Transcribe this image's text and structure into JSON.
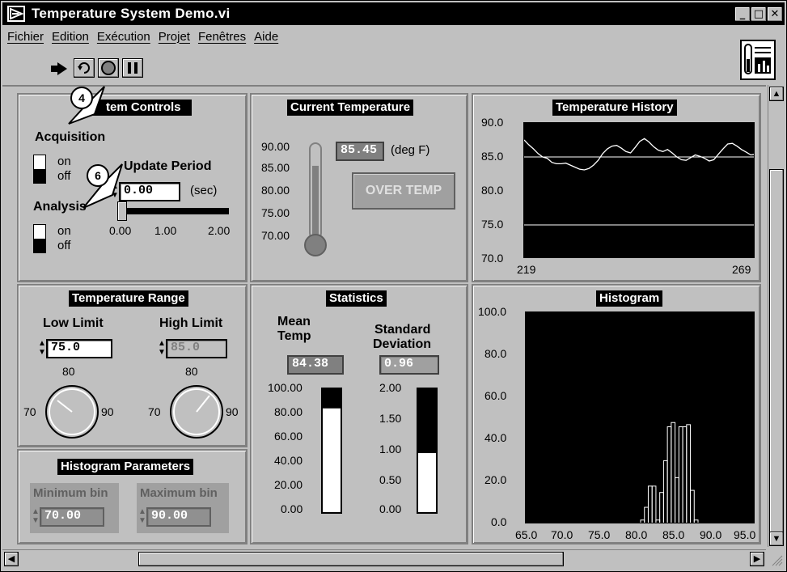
{
  "window": {
    "title": "Temperature System Demo.vi"
  },
  "menu": [
    "Fichier",
    "Edition",
    "Exécution",
    "Projet",
    "Fenêtres",
    "Aide"
  ],
  "callouts": [
    "4",
    "6"
  ],
  "system_controls": {
    "title": "System Controls",
    "visible_title": "tem Controls",
    "acquisition_label": "Acquisition",
    "analysis_label": "Analysis",
    "on": "on",
    "off": "off",
    "update_period_label": "Update Period",
    "update_period_value": "0.00",
    "update_period_unit": "(sec)",
    "slider_ticks": [
      "0.00",
      "1.00",
      "2.00"
    ]
  },
  "current_temp": {
    "title": "Current Temperature",
    "value": "85.45",
    "unit": "(deg F)",
    "over_temp_label": "OVER TEMP",
    "scale": [
      "90.00",
      "85.00",
      "80.00",
      "75.00",
      "70.00"
    ]
  },
  "temp_history": {
    "title": "Temperature History",
    "y_ticks": [
      "90.0",
      "85.0",
      "80.0",
      "75.0",
      "70.0"
    ],
    "x_ticks": [
      "219",
      "269"
    ]
  },
  "temp_range": {
    "title": "Temperature Range",
    "low_label": "Low Limit",
    "high_label": "High Limit",
    "low_value": "75.0",
    "high_value": "85.0",
    "knob_top": "80",
    "knob_min": "70",
    "knob_max": "90"
  },
  "statistics": {
    "title": "Statistics",
    "mean_label_1": "Mean",
    "mean_label_2": "Temp",
    "std_label_1": "Standard",
    "std_label_2": "Deviation",
    "mean_value": "84.38",
    "std_value": "0.96",
    "mean_scale": [
      "100.00",
      "80.00",
      "60.00",
      "40.00",
      "20.00",
      "0.00"
    ],
    "std_scale": [
      "2.00",
      "1.50",
      "1.00",
      "0.50",
      "0.00"
    ]
  },
  "histogram": {
    "title": "Histogram",
    "y_ticks": [
      "100.0",
      "80.0",
      "60.0",
      "40.0",
      "20.0",
      "0.0"
    ],
    "x_ticks": [
      "65.0",
      "70.0",
      "75.0",
      "80.0",
      "85.0",
      "90.0",
      "95.0"
    ]
  },
  "histogram_params": {
    "title": "Histogram Parameters",
    "min_label": "Minimum bin",
    "max_label": "Maximum bin",
    "min_value": "70.00",
    "max_value": "90.00"
  },
  "chart_data": [
    {
      "type": "line",
      "title": "Temperature History",
      "xlim": [
        219,
        269
      ],
      "ylim": [
        70,
        90
      ],
      "series": [
        {
          "values": [
            87.5,
            86.8,
            86.2,
            85.5,
            85.0,
            84.8,
            84.2,
            84.0,
            84.0,
            84.1,
            83.8,
            83.5,
            83.2,
            83.1,
            83.3,
            83.8,
            84.5,
            85.5,
            86.2,
            86.6,
            86.7,
            86.3,
            85.8,
            85.6,
            86.4,
            87.3,
            87.7,
            87.2,
            86.5,
            86.0,
            85.8,
            86.1,
            85.6,
            85.0,
            84.6,
            84.5,
            84.9,
            85.3,
            85.1,
            84.8,
            84.4,
            84.6,
            85.4,
            86.2,
            86.9,
            87.0,
            86.6,
            86.1,
            85.7,
            85.3,
            85.4
          ]
        }
      ],
      "reference_lines": [
        85.0,
        75.0
      ]
    },
    {
      "type": "bar",
      "title": "Histogram",
      "xlim": [
        65,
        95
      ],
      "ylim": [
        0,
        100
      ],
      "bins_x": [
        80.0,
        80.5,
        81.0,
        81.5,
        82.0,
        82.5,
        83.0,
        83.5,
        84.0,
        84.5,
        85.0,
        85.5,
        86.0,
        86.5,
        87.0
      ],
      "values": [
        2,
        8,
        18,
        18,
        2,
        15,
        30,
        46,
        48,
        22,
        46,
        46,
        47,
        16,
        2
      ]
    },
    {
      "type": "bar",
      "title": "Mean Temp",
      "ylim": [
        0,
        100
      ],
      "values": [
        84.38
      ]
    },
    {
      "type": "bar",
      "title": "Standard Deviation",
      "ylim": [
        0,
        2
      ],
      "values": [
        0.96
      ]
    }
  ]
}
